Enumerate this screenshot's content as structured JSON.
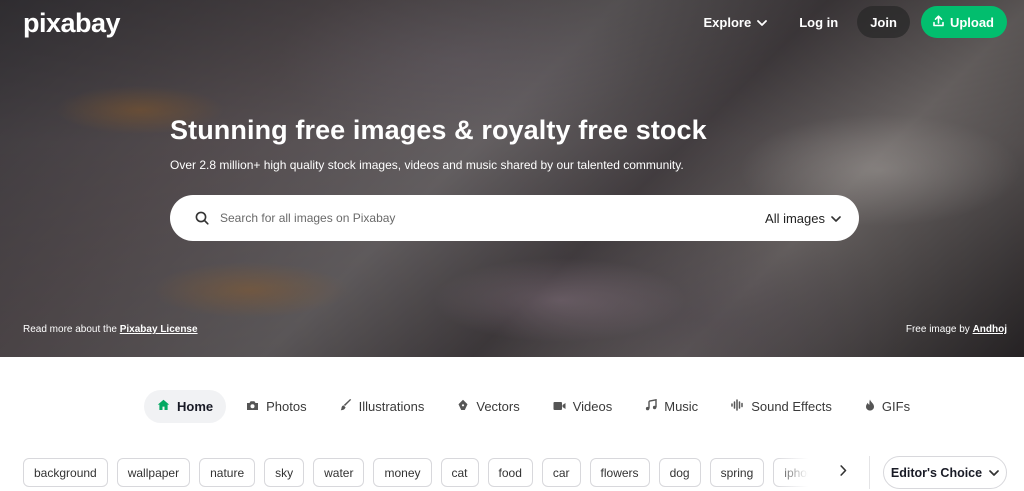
{
  "brand": {
    "logo_text": "pixabay",
    "accent_color": "#02be6e"
  },
  "nav": {
    "explore": "Explore",
    "login": "Log in",
    "join": "Join",
    "upload": "Upload"
  },
  "hero": {
    "title": "Stunning free images & royalty free stock",
    "subtitle": "Over 2.8 million+ high quality stock images, videos and music shared by our talented community.",
    "license_prefix": "Read more about the ",
    "license_link": "Pixabay License",
    "credit_prefix": "Free image by ",
    "credit_author": "Andhoj"
  },
  "search": {
    "placeholder": "Search for all images on Pixabay",
    "value": "",
    "type_selected": "All images"
  },
  "tabs": [
    {
      "label": "Home",
      "icon": "home-icon",
      "active": true
    },
    {
      "label": "Photos",
      "icon": "camera-icon",
      "active": false
    },
    {
      "label": "Illustrations",
      "icon": "brush-icon",
      "active": false
    },
    {
      "label": "Vectors",
      "icon": "pen-nib-icon",
      "active": false
    },
    {
      "label": "Videos",
      "icon": "video-camera-icon",
      "active": false
    },
    {
      "label": "Music",
      "icon": "music-note-icon",
      "active": false
    },
    {
      "label": "Sound Effects",
      "icon": "waveform-icon",
      "active": false
    },
    {
      "label": "GIFs",
      "icon": "flame-icon",
      "active": false
    }
  ],
  "chips": [
    "background",
    "wallpaper",
    "nature",
    "sky",
    "water",
    "money",
    "cat",
    "food",
    "car",
    "flowers",
    "dog",
    "spring",
    "iphone"
  ],
  "filter": {
    "editors_choice": "Editor's Choice"
  }
}
